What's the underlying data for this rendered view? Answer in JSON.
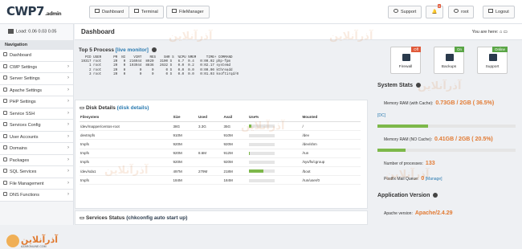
{
  "app": {
    "logo": "CWP7",
    "logo_suffix": ".admin"
  },
  "top_nav": {
    "dashboard": "Dashboard",
    "terminal": "Terminal",
    "filemanager": "FileManager",
    "support": "Support",
    "notif_count": "0",
    "user": "root",
    "logout": "Logout"
  },
  "load": "Load: 0.06  0.03  0.05",
  "sidebar": {
    "heading": "Navigation",
    "items": [
      "Dashboard",
      "CWP Settings",
      "Server Settings",
      "Apache Settings",
      "PHP Settings",
      "Service SSH",
      "Services Config",
      "User Accounts",
      "Domains",
      "Packages",
      "SQL Services",
      "File Management",
      "DNS Functions"
    ]
  },
  "page": {
    "title": "Dashboard",
    "here": "You are here:"
  },
  "top5": {
    "title": "Top 5 Process",
    "link": "[live monitor]",
    "lines": [
      "  PID USER      PR  NI    VIRT    RES    SHR S  %CPU %MEM     TIME+ COMMAND",
      "19317 root      20   0  216944  8920   3100 S   6.7  0.4   0:00.02 php-fpm",
      "    1 root      20   0  193944  8836   2632 S   0.0  0.2   0:02.17 systemd",
      "    2 root      20   0       0     0      0 S   0.0  0.0   0:00.00 kthreadd",
      "    3 root      20   0       0     0      0 S   0.0  0.0   0:01.03 ksoftirqd/0"
    ]
  },
  "disk": {
    "title": "Disk Details",
    "link": "(disk details)",
    "headers": [
      "Filesystem",
      "Size",
      "Used",
      "Avail",
      "Use%",
      "Mounted"
    ],
    "rows": [
      {
        "fs": "/dev/mapper/centos-root",
        "size": "38G",
        "used": "3.3G",
        "avail": "35G",
        "pct": 9,
        "mount": "/"
      },
      {
        "fs": "devtmpfs",
        "size": "910M",
        "used": "",
        "avail": "910M",
        "pct": 0,
        "mount": "/dev"
      },
      {
        "fs": "tmpfs",
        "size": "920M",
        "used": "",
        "avail": "920M",
        "pct": 0,
        "mount": "/dev/shm"
      },
      {
        "fs": "tmpfs",
        "size": "920M",
        "used": "8.6M",
        "avail": "912M",
        "pct": 1,
        "mount": "/run"
      },
      {
        "fs": "tmpfs",
        "size": "920M",
        "used": "",
        "avail": "920M",
        "pct": 0,
        "mount": "/sys/fs/cgroup"
      },
      {
        "fs": "/dev/sda1",
        "size": "497M",
        "used": "279M",
        "avail": "218M",
        "pct": 57,
        "mount": "/boot"
      },
      {
        "fs": "tmpfs",
        "size": "184M",
        "used": "",
        "avail": "184M",
        "pct": 0,
        "mount": "/run/user/0"
      }
    ]
  },
  "services": {
    "title": "Services Status",
    "link": "(chkconfig auto start up)"
  },
  "cards": [
    {
      "label": "Firewall",
      "badge": "Off",
      "badge_color": "#e05a3a"
    },
    {
      "label": "Backups",
      "badge": "On",
      "badge_color": "#5aa546"
    },
    {
      "label": "Support",
      "badge": "Online",
      "badge_color": "#5aa546"
    }
  ],
  "stats": {
    "title": "System Stats",
    "ram_cache_label": "Memory RAM (with Cache):",
    "ram_cache": "0.73GB / 2GB ( 36.5%)",
    "dc": "[DC]",
    "ram_cache_pct": 36.5,
    "ram_nocache_label": "Memory RAM (NO Cache):",
    "ram_nocache": "0.41GB / 2GB ( 20.5%)",
    "ram_nocache_pct": 20.5,
    "procs_label": "Number of processes:",
    "procs": "133",
    "mailq_label": "Postfix Mail Queue:",
    "mailq": "0",
    "manage": "[Manage]"
  },
  "version": {
    "title": "Application Version",
    "apache_label": "Apache version:",
    "apache": "Apache/2.4.29"
  },
  "watermark": {
    "text": "آذرآنلاین",
    "logo_sub": "AZARONLINE.COM"
  }
}
